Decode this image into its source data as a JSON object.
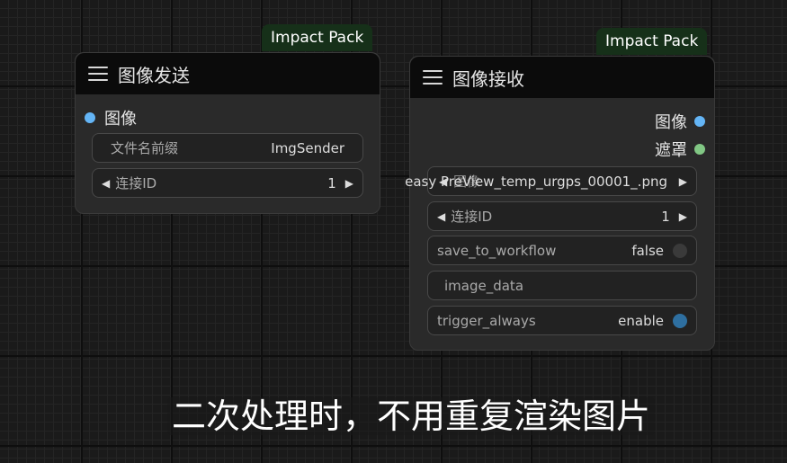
{
  "colors": {
    "canvas": "#1a1a1a",
    "node_body": "#2a2a2a",
    "node_header": "#0b0b0b",
    "badge_bg": "#163019",
    "slot_image": "#64b5f6",
    "slot_mask": "#81c784",
    "toggle_on": "#2e6fa0",
    "toggle_off": "#3a3a3a"
  },
  "node_sender": {
    "badge": "Impact Pack",
    "title": "图像发送",
    "input_slot": "图像",
    "widgets": {
      "prefix_label": "文件名前缀",
      "prefix_value": "ImgSender",
      "link_id_label": "连接ID",
      "link_id_value": "1"
    }
  },
  "node_receiver": {
    "badge": "Impact Pack",
    "title": "图像接收",
    "output_slots": [
      "图像",
      "遮罩"
    ],
    "widgets": {
      "image_overlap_label": "图像",
      "image_value": "easy PreView_temp_urgps_00001_.png",
      "link_id_label": "连接ID",
      "link_id_value": "1",
      "save_label": "save_to_workflow",
      "save_value": "false",
      "image_data_label": "image_data",
      "trigger_label": "trigger_always",
      "trigger_value": "enable"
    }
  },
  "caption": "二次处理时，不用重复渲染图片"
}
